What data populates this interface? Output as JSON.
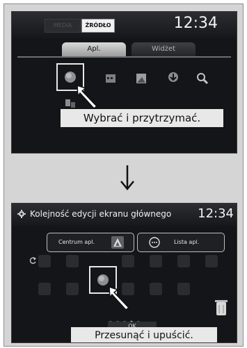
{
  "step1": {
    "source_media_label": "MEDIA",
    "source_label": "ŹRÓDŁO",
    "clock": "12:34",
    "tabs": [
      {
        "label": "Apl."
      },
      {
        "label": "Widżet"
      }
    ],
    "instruction": "Wybrać i przytrzymać."
  },
  "step2": {
    "title": "Kolejność edycji ekranu głównego",
    "clock": "12:34",
    "centrum_button": "Centrum apl.",
    "lista_button": "Lista apl.",
    "ok_button": "OK",
    "instruction": "Przesunąć i upuścić.",
    "pages": {
      "count": 5,
      "current": 4
    }
  },
  "colors": {
    "screen_bg": "#141518",
    "callout_bg": "#e8e8e8",
    "frame_bg": "#d5d5d5"
  }
}
